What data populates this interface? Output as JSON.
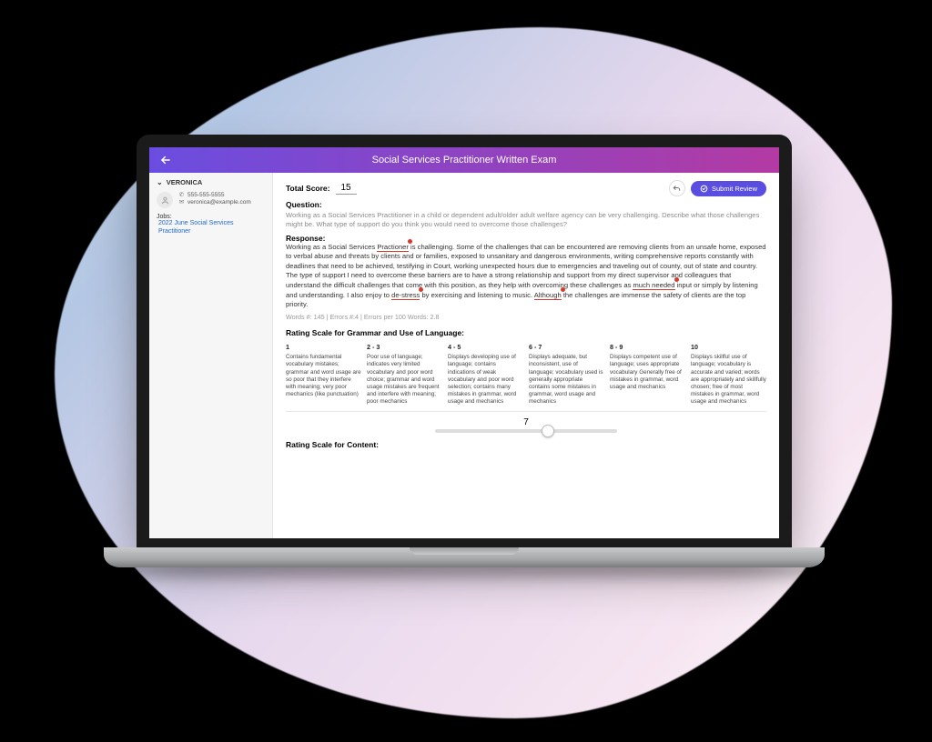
{
  "header": {
    "title": "Social Services Practitioner Written Exam"
  },
  "sidebar": {
    "candidate_name": "VERONICA",
    "phone": "555-555-5555",
    "email": "veronica@example.com",
    "jobs_label": "Jobs:",
    "job_link": "2022 June Social Services Practitioner"
  },
  "score": {
    "label": "Total Score:",
    "value": "15",
    "submit_label": "Submit Review"
  },
  "question": {
    "label": "Question:",
    "text": "Working as a Social Services Practitioner in a child or dependent adult/older adult welfare agency can be very challenging. Describe what those challenges might be. What type of support do you think you would need to overcome those challenges?"
  },
  "response": {
    "label": "Response:",
    "pre1": "Working as a Social Services ",
    "err1": "Practioner",
    "mid1": " is challenging. Some of the challenges that can be encountered are removing clients from an unsafe home, exposed to verbal abuse and threats by clients and or families, exposed to unsanitary and dangerous environments, writing comprehensive reports constantly with deadlines that need to be achieved, testifying in Court, working unexpected hours due to emergencies and traveling out of county, out of state and country. The type of support I need to overcome these barriers are to have a strong relationship and support from my direct supervisor and colleagues that understand the difficult challenges that come with this position, as they help with overcoming these challenges as ",
    "err2": "much needed",
    "mid2": " input or simply by listening and understanding. I also enjoy to ",
    "err3": "de-stress",
    "mid3": " by exercising and listening to music. ",
    "err4": "Although",
    "post": " the challenges are immense the safety of clients are the top priority.",
    "stats": "Words #: 145 | Errors #:4 | Errors per 100 Words: 2.8"
  },
  "rating_grammar": {
    "heading": "Rating Scale for Grammar and Use of Language:",
    "cols": [
      {
        "head": "1",
        "text": "Contains fundamental vocabulary mistakes; grammar and word usage are so poor that they interfere with meaning; very poor mechanics (like punctuation)"
      },
      {
        "head": "2 - 3",
        "text": "Poor use of language; indicates very limited vocabulary and poor word choice; grammar and word usage mistakes are frequent and interfere with meaning; poor mechanics"
      },
      {
        "head": "4 - 5",
        "text": "Displays developing use of language; contains indications of weak vocabulary and poor word selection; contains many mistakes in grammar, word usage and mechanics"
      },
      {
        "head": "6 - 7",
        "text": "Displays adequate, but inconsistent, use of language; vocabulary used is generally appropriate contains some mistakes in grammar, word usage and mechanics"
      },
      {
        "head": "8 - 9",
        "text": "Displays competent use of language; uses appropriate vocabulary Generally free of mistakes in grammar, word usage and mechanics"
      },
      {
        "head": "10",
        "text": "Displays skillful use of language; vocabulary is accurate and varied; words are appropriately and skillfully chosen; free of most mistakes in grammar, word usage and mechanics"
      }
    ],
    "slider_value": "7"
  },
  "rating_content": {
    "heading": "Rating Scale for Content:"
  }
}
